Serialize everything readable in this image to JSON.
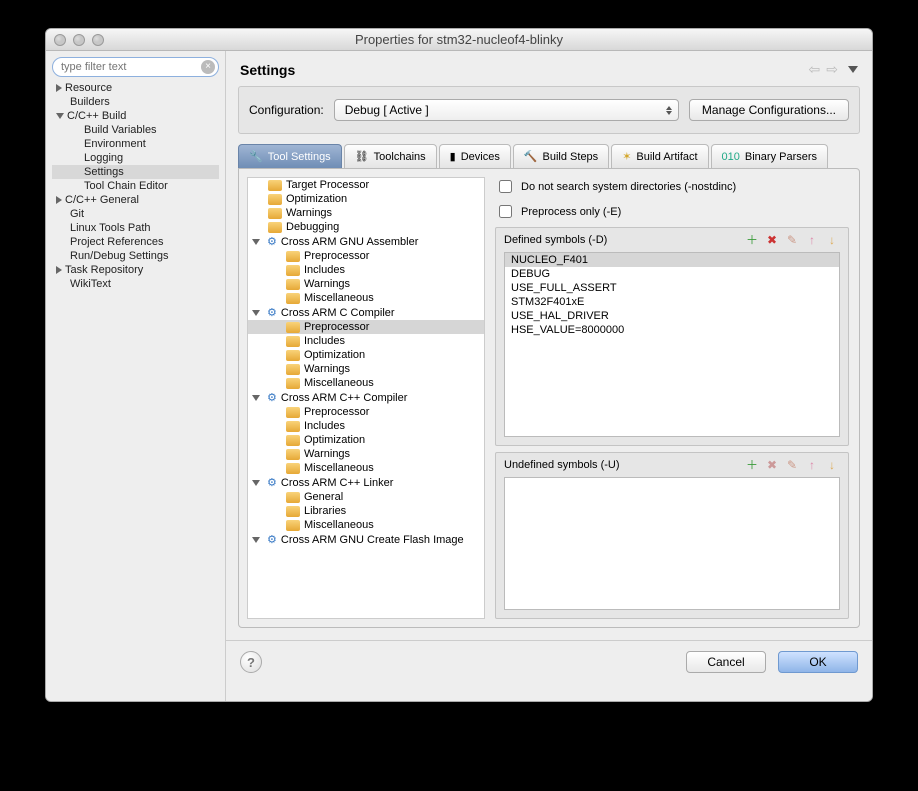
{
  "window": {
    "title": "Properties for stm32-nucleof4-blinky"
  },
  "nav": {
    "filter_placeholder": "type filter text",
    "items": {
      "resource": "Resource",
      "builders": "Builders",
      "ccbuild": "C/C++ Build",
      "build_variables": "Build Variables",
      "environment": "Environment",
      "logging": "Logging",
      "settings": "Settings",
      "tool_chain_editor": "Tool Chain Editor",
      "ccgeneral": "C/C++ General",
      "git": "Git",
      "linux_tools_path": "Linux Tools Path",
      "project_references": "Project References",
      "run_debug": "Run/Debug Settings",
      "task_repository": "Task Repository",
      "wikitext": "WikiText"
    }
  },
  "heading": "Settings",
  "config": {
    "label": "Configuration:",
    "value": "Debug  [ Active ]",
    "manage_label": "Manage Configurations..."
  },
  "tabs": {
    "tool_settings": "Tool Settings",
    "toolchains": "Toolchains",
    "devices": "Devices",
    "build_steps": "Build Steps",
    "build_artifact": "Build Artifact",
    "binary_parsers": "Binary Parsers"
  },
  "settings_tree": {
    "target_processor": "Target Processor",
    "optimization": "Optimization",
    "warnings": "Warnings",
    "debugging": "Debugging",
    "asm": "Cross ARM GNU Assembler",
    "preprocessor": "Preprocessor",
    "includes": "Includes",
    "miscellaneous": "Miscellaneous",
    "ccomp": "Cross ARM C Compiler",
    "cppcomp": "Cross ARM C++ Compiler",
    "linker": "Cross ARM C++ Linker",
    "general": "General",
    "libraries": "Libraries",
    "flash": "Cross ARM GNU Create Flash Image"
  },
  "checks": {
    "nostdinc": "Do not search system directories (-nostdinc)",
    "preprocess_only": "Preprocess only (-E)"
  },
  "defined": {
    "label": "Defined symbols (-D)",
    "symbols": [
      "NUCLEO_F401",
      "DEBUG",
      "USE_FULL_ASSERT",
      "STM32F401xE",
      "USE_HAL_DRIVER",
      "HSE_VALUE=8000000"
    ]
  },
  "undefined": {
    "label": "Undefined symbols (-U)"
  },
  "footer": {
    "cancel": "Cancel",
    "ok": "OK"
  }
}
